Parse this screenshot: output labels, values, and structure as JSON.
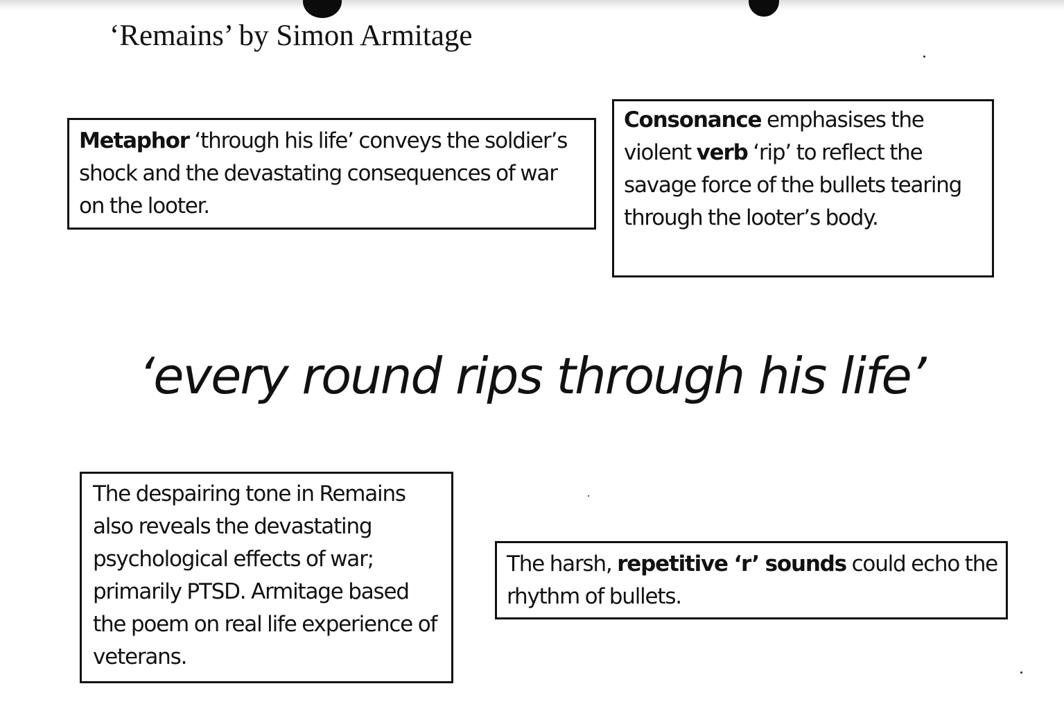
{
  "document": {
    "title": "‘Remains’ by Simon Armitage",
    "quote": "‘every round rips through his life’"
  },
  "boxes": {
    "metaphor": {
      "term": "Metaphor",
      "text": " ‘through his life’ conveys the soldier’s shock and the devastating consequences of war on the looter."
    },
    "consonance": {
      "term": "Consonance",
      "text_1": " emphasises the violent ",
      "term_2": "verb",
      "text_2": " ‘rip’ to reflect the savage force of the bullets tearing through the looter’s body."
    },
    "tone": {
      "text": "The despairing tone in Remains also reveals the devastating psychological effects of war; primarily PTSD. Armitage based the poem on real life experience of veterans."
    },
    "harsh": {
      "text_1": "The harsh, ",
      "term": "repetitive ‘r’ sounds",
      "text_2": " could echo the rhythm of bullets."
    }
  }
}
